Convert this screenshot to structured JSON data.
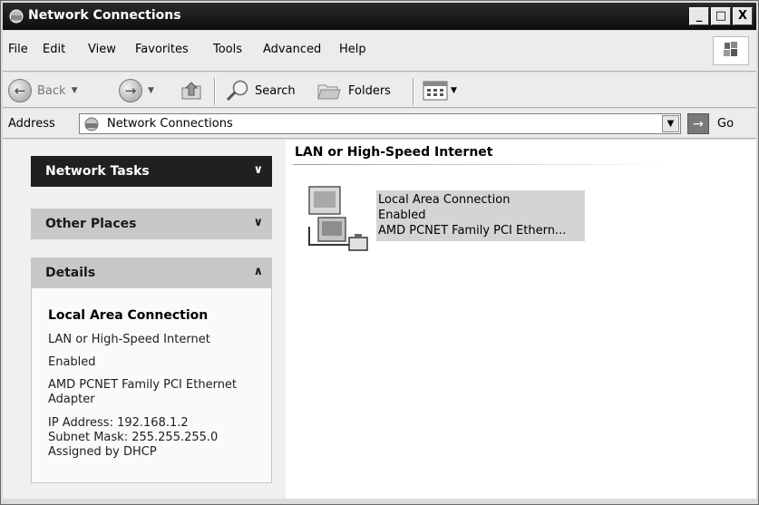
{
  "window": {
    "title": "Network Connections",
    "minimize": "_",
    "maximize": "□",
    "close": "X"
  },
  "menu": [
    "File",
    "Edit",
    "View",
    "Favorites",
    "Tools",
    "Advanced",
    "Help"
  ],
  "toolbar": {
    "back": "Back",
    "search": "Search",
    "folders": "Folders"
  },
  "address": {
    "label": "Address",
    "value": "Network Connections",
    "go": "Go"
  },
  "tasks": {
    "network_tasks": "Network Tasks",
    "other_places": "Other Places",
    "details": "Details"
  },
  "details": {
    "title": "Local Area Connection",
    "type": "LAN or High-Speed Internet",
    "status": "Enabled",
    "adapter_line1": "AMD PCNET Family PCI Ethernet",
    "adapter_line2": "Adapter",
    "ip": "IP Address: 192.168.1.2",
    "subnet": "Subnet Mask: 255.255.255.0",
    "assigned": "Assigned by DHCP"
  },
  "group": {
    "heading": "LAN or High-Speed Internet"
  },
  "connection": {
    "name": "Local Area Connection",
    "status": "Enabled",
    "device": "AMD PCNET Family PCI Ethern..."
  },
  "icons": [
    "network-connections-icon",
    "back-icon",
    "forward-icon",
    "up-folder-icon",
    "search-icon",
    "folders-icon",
    "views-icon",
    "go-arrow-icon",
    "lan-connection-icon",
    "windows-logo-icon"
  ]
}
